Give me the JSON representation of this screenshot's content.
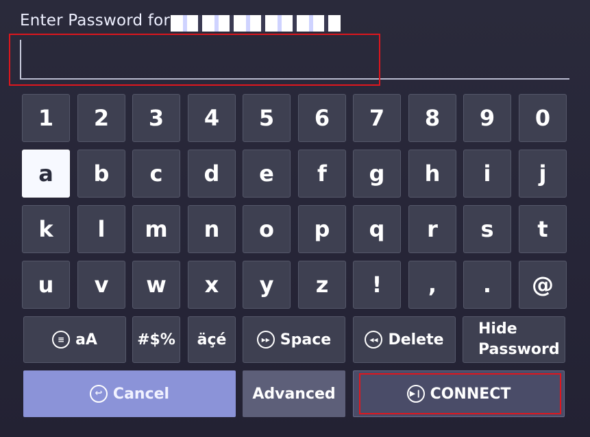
{
  "dialog": {
    "title": "Enter Password for",
    "password_value": ""
  },
  "keyboard": {
    "row1": [
      "1",
      "2",
      "3",
      "4",
      "5",
      "6",
      "7",
      "8",
      "9",
      "0"
    ],
    "row2": [
      "a",
      "b",
      "c",
      "d",
      "e",
      "f",
      "g",
      "h",
      "i",
      "j"
    ],
    "row3": [
      "k",
      "l",
      "m",
      "n",
      "o",
      "p",
      "q",
      "r",
      "s",
      "t"
    ],
    "row4": [
      "u",
      "v",
      "w",
      "x",
      "y",
      "z",
      "!",
      ",",
      ".",
      "@"
    ],
    "caps_label": "aA",
    "symbols_label": "#$%",
    "accents_label": "äçé",
    "space_label": "Space",
    "delete_label": "Delete",
    "hide_line1": "Hide",
    "hide_line2": "Password",
    "selected_key": "a"
  },
  "actions": {
    "cancel_label": "Cancel",
    "advanced_label": "Advanced",
    "connect_label": "CONNECT"
  },
  "colors": {
    "background": "#262537",
    "key": "#3e4051",
    "selected_key": "#f7f9ff",
    "cancel": "#8b93d8",
    "highlight_box": "#e0161d"
  }
}
